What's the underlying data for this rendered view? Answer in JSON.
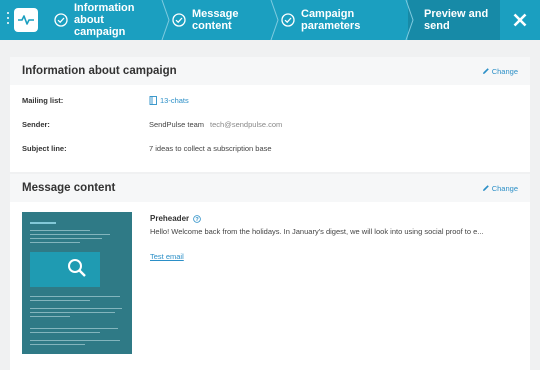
{
  "wizard": {
    "steps": [
      {
        "label_line1": "Information about",
        "label_line2": "campaign",
        "icon": "check-circle-icon"
      },
      {
        "label": "Message content",
        "icon": "check-circle-icon"
      },
      {
        "label": "Campaign parameters",
        "icon": "check-circle-icon"
      },
      {
        "label": "Preview and send"
      }
    ],
    "close_icon": "close-icon",
    "accent": "#1b9fc0",
    "active_bg": "#178aa7"
  },
  "info": {
    "title": "Information about campaign",
    "change_label": "Change",
    "mailing_list_label": "Mailing list:",
    "mailing_list_value": "13-chats",
    "sender_label": "Sender:",
    "sender_name": "SendPulse team",
    "sender_email": "tech@sendpulse.com",
    "subject_label": "Subject line:",
    "subject_value": "7 ideas to collect a subscription base"
  },
  "content": {
    "title": "Message content",
    "change_label": "Change",
    "preheader_label": "Preheader",
    "preheader_text": "Hello! Welcome back from the holidays. In January's digest, we will look into using social proof to e...",
    "test_email_label": "Test email"
  }
}
